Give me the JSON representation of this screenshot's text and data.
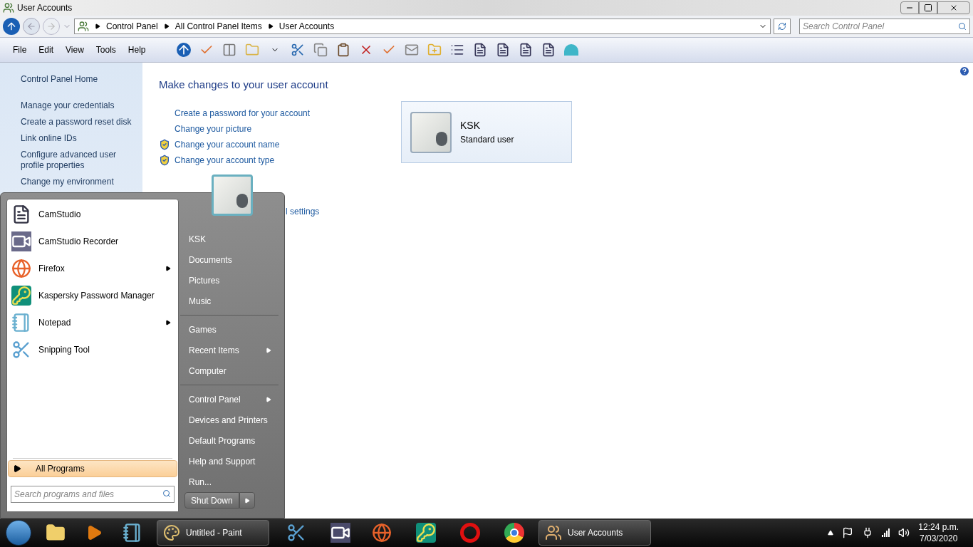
{
  "window": {
    "title": "User Accounts",
    "breadcrumbs": [
      "Control Panel",
      "All Control Panel Items",
      "User Accounts"
    ],
    "search_placeholder": "Search Control Panel",
    "menu": [
      "File",
      "Edit",
      "View",
      "Tools",
      "Help"
    ]
  },
  "sidebar": {
    "home": "Control Panel Home",
    "items": [
      "Manage your credentials",
      "Create a password reset disk",
      "Link online IDs",
      "Configure advanced user profile properties",
      "Change my environment"
    ]
  },
  "main": {
    "heading": "Make changes to your user account",
    "links": [
      {
        "text": "Create a password for your account",
        "shield": false
      },
      {
        "text": "Change your picture",
        "shield": false
      },
      {
        "text": "Change your account name",
        "shield": true
      },
      {
        "text": "Change your account type",
        "shield": true
      }
    ],
    "partial_link": "l settings",
    "account": {
      "name": "KSK",
      "type": "Standard user"
    }
  },
  "start_menu": {
    "programs": [
      {
        "name": "CamStudio",
        "submenu": false
      },
      {
        "name": "CamStudio Recorder",
        "submenu": false
      },
      {
        "name": "Firefox",
        "submenu": true
      },
      {
        "name": "Kaspersky Password Manager",
        "submenu": false
      },
      {
        "name": "Notepad",
        "submenu": true
      },
      {
        "name": "Snipping Tool",
        "submenu": false
      }
    ],
    "all_programs": "All Programs",
    "search_placeholder": "Search programs and files",
    "place_groups": [
      [
        {
          "label": "KSK",
          "submenu": false
        },
        {
          "label": "Documents",
          "submenu": false
        },
        {
          "label": "Pictures",
          "submenu": false
        },
        {
          "label": "Music",
          "submenu": false
        }
      ],
      [
        {
          "label": "Games",
          "submenu": false
        },
        {
          "label": "Recent Items",
          "submenu": true
        },
        {
          "label": "Computer",
          "submenu": false
        }
      ],
      [
        {
          "label": "Control Panel",
          "submenu": true
        },
        {
          "label": "Devices and Printers",
          "submenu": false
        },
        {
          "label": "Default Programs",
          "submenu": false
        },
        {
          "label": "Help and Support",
          "submenu": false
        },
        {
          "label": "Run...",
          "submenu": false
        }
      ]
    ],
    "shut_down": "Shut Down"
  },
  "taskbar": {
    "paint": "Untitled - Paint",
    "user_accounts": "User Accounts",
    "time": "12:24 p.m.",
    "date": "7/03/2020"
  }
}
